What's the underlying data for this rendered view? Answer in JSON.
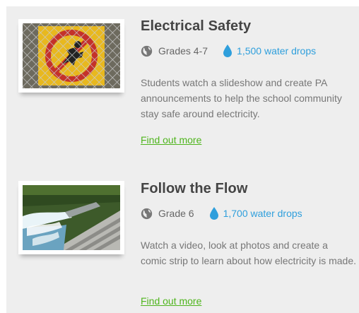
{
  "activities": [
    {
      "title": "Electrical Safety",
      "grades": "Grades 4-7",
      "drops": "1,500 water drops",
      "description": "Students watch a slideshow and create PA announcements to help the school community stay safe around electricity.",
      "link": "Find out more",
      "image": "electrical-hazard-sign-on-fence",
      "grades_icon": "globe-icon",
      "drops_icon": "water-drop-icon"
    },
    {
      "title": "Follow the Flow",
      "grades": "Grade 6",
      "drops": "1,700 water drops",
      "description": "Watch a video, look at photos and create a comic strip to learn about how electricity is made.",
      "link": "Find out more",
      "image": "dam-spillway-photo",
      "grades_icon": "globe-icon",
      "drops_icon": "water-drop-icon"
    }
  ],
  "colors": {
    "title": "#444444",
    "drops": "#2f9fdc",
    "link": "#4fb51d",
    "background": "#eeeeee"
  }
}
